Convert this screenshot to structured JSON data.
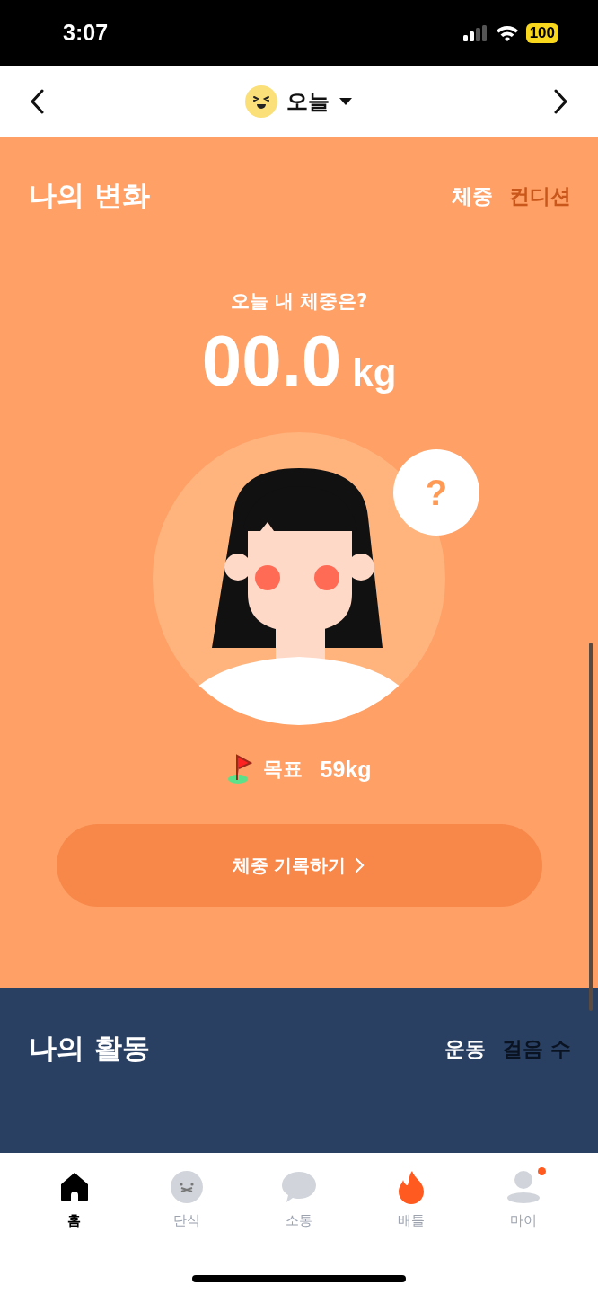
{
  "status_bar": {
    "time": "3:07",
    "battery": "100"
  },
  "header": {
    "title": "오늘"
  },
  "weight_section": {
    "title": "나의 변화",
    "tabs": [
      {
        "label": "체중",
        "selected": true
      },
      {
        "label": "컨디션",
        "selected": false
      }
    ],
    "question": "오늘 내 체중은?",
    "value": "00.0",
    "unit": "kg",
    "bubble": "?",
    "goal_label": "목표",
    "goal_value": "59kg",
    "button": "체중 기록하기"
  },
  "activity_section": {
    "title": "나의 활동",
    "tabs": [
      {
        "label": "운동",
        "selected": true
      },
      {
        "label": "걸음 수",
        "selected": false
      }
    ]
  },
  "nav": [
    {
      "kind": "home",
      "label": "홈",
      "selected": true,
      "badge": false
    },
    {
      "kind": "fasting",
      "label": "단식",
      "selected": false,
      "badge": false
    },
    {
      "kind": "chat",
      "label": "소통",
      "selected": false,
      "badge": false
    },
    {
      "kind": "battle",
      "label": "배틀",
      "selected": false,
      "badge": false
    },
    {
      "kind": "profile",
      "label": "마이",
      "selected": false,
      "badge": true
    }
  ]
}
